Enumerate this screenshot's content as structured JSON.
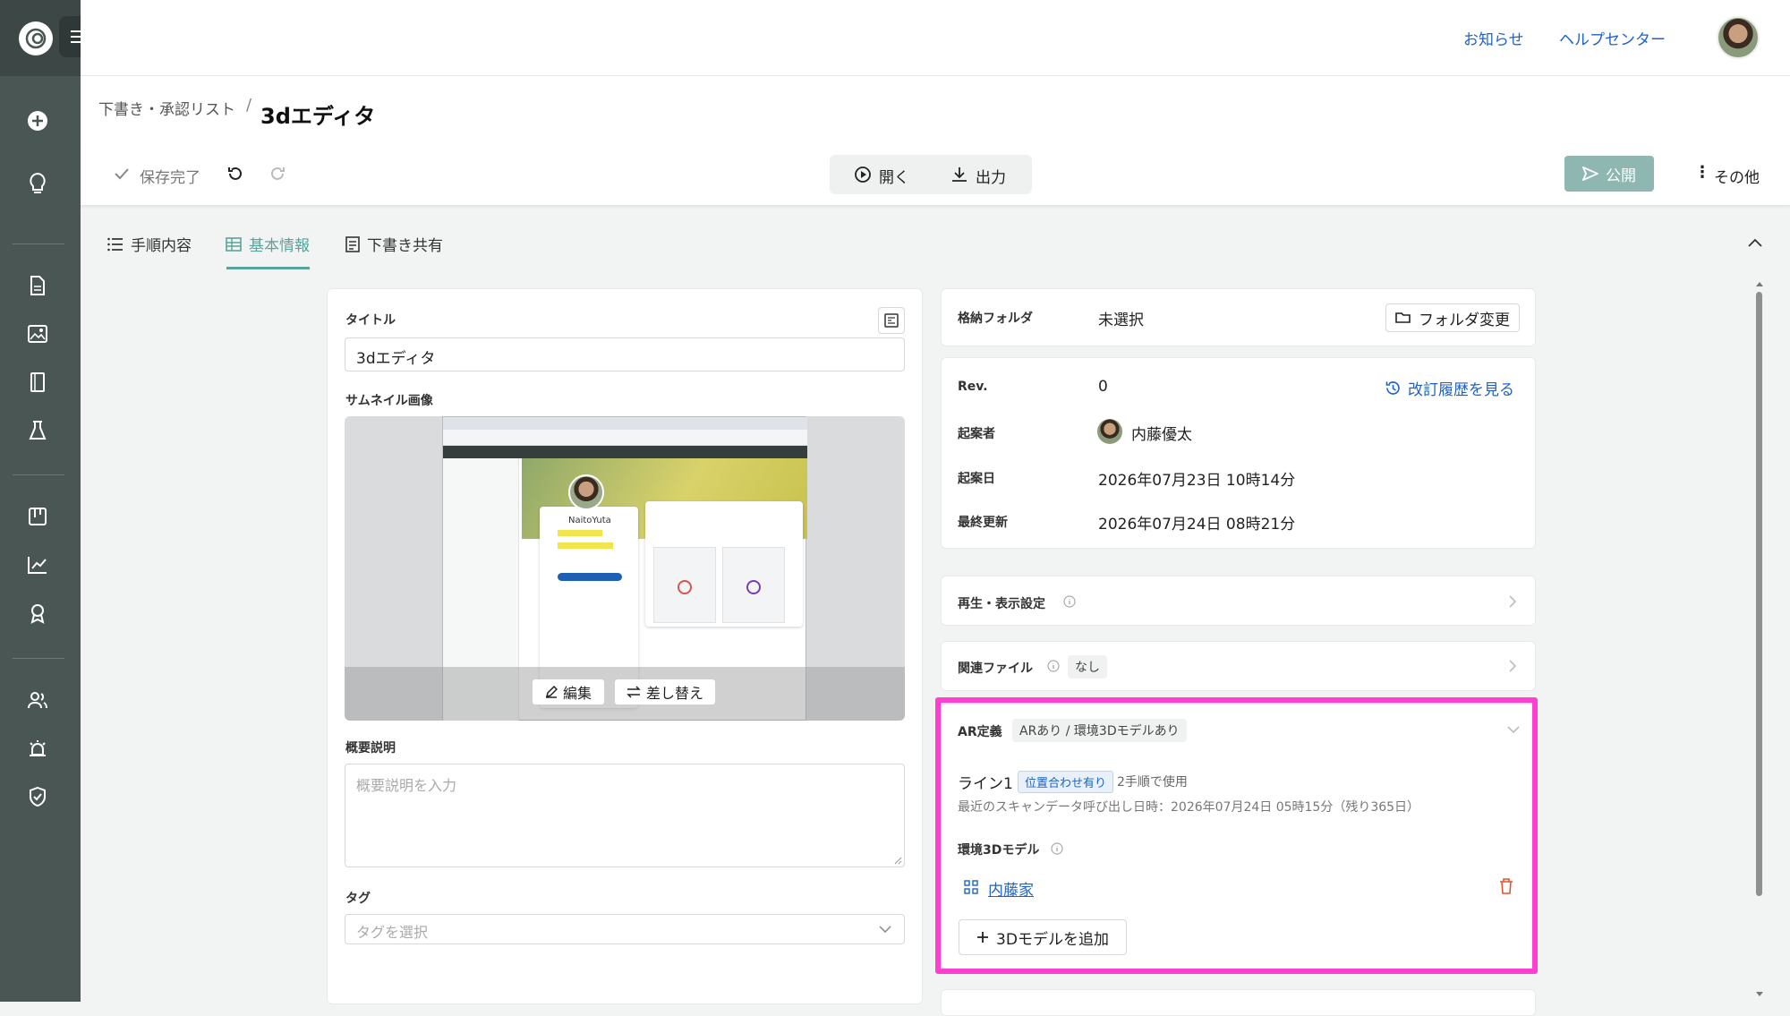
{
  "header": {
    "news": "お知らせ",
    "help_center": "ヘルプセンター"
  },
  "breadcrumb": {
    "parent": "下書き・承認リスト",
    "separator": "/",
    "current": "3dエディタ"
  },
  "toolbar": {
    "saved": "保存完了",
    "open": "開く",
    "export": "出力",
    "publish": "公開",
    "more": "その他"
  },
  "tabs": [
    {
      "label": "手順内容"
    },
    {
      "label": "基本情報"
    },
    {
      "label": "下書き共有"
    }
  ],
  "form": {
    "title_label": "タイトル",
    "title_value": "3dエディタ",
    "thumb_label": "サムネイル画像",
    "thumb_edit": "編集",
    "thumb_replace": "差し替え",
    "thumb_caption": "NaitoYuta",
    "desc_label": "概要説明",
    "desc_placeholder": "概要説明を入力",
    "tag_label": "タグ",
    "tag_placeholder": "タグを選択"
  },
  "folder": {
    "label": "格納フォルダ",
    "value": "未選択",
    "button": "フォルダ変更"
  },
  "info": {
    "rev_label": "Rev.",
    "rev_value": "0",
    "history": "改訂履歴を見る",
    "author_label": "起案者",
    "author_value": "内藤優太",
    "created_label": "起案日",
    "created_value": "2026年07月23日 10時14分",
    "updated_label": "最終更新",
    "updated_value": "2026年07月24日 08時21分"
  },
  "playback": {
    "label": "再生・表示設定"
  },
  "related": {
    "label": "関連ファイル",
    "badge": "なし"
  },
  "ar": {
    "label": "AR定義",
    "badge": "ARあり / 環境3Dモデルあり",
    "line_name": "ライン1",
    "line_badge": "位置合わせ有り",
    "line_usage": "2手順で使用",
    "scan_info": "最近のスキャンデータ呼び出し日時：2026年07月24日 05時15分（残り365日）",
    "env_label": "環境3Dモデル",
    "model_name": "内藤家",
    "add_button": "3Dモデルを追加"
  },
  "colors": {
    "sidebar": "#4a5654",
    "accent": "#5aa39a",
    "link": "#1e63c4",
    "highlight": "#ff3fcf",
    "delete": "#e0542e",
    "publish": "#8fb7b2"
  }
}
